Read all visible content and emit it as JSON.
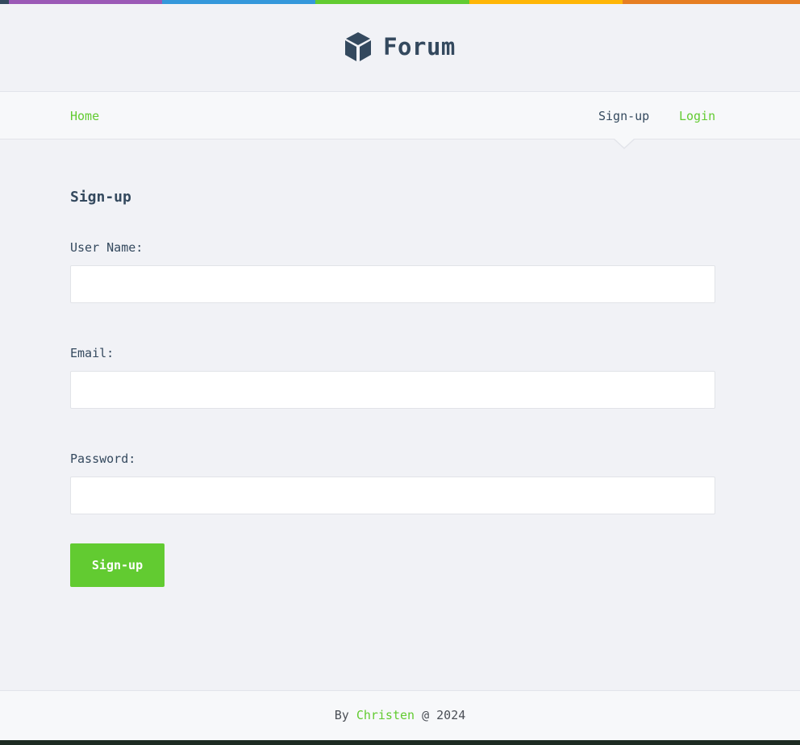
{
  "top_bar_colors": [
    "#34495e",
    "#9b59b6",
    "#3498db",
    "#62cb31",
    "#ffb606",
    "#e67e22"
  ],
  "header": {
    "logo_icon": "cube-icon",
    "title": "Forum"
  },
  "nav": {
    "home": "Home",
    "signup": "Sign-up",
    "login": "Login",
    "active": "Sign-up"
  },
  "form": {
    "title": "Sign-up",
    "username_label": "User Name:",
    "username_value": "",
    "email_label": "Email:",
    "email_value": "",
    "password_label": "Password:",
    "password_value": "",
    "submit_label": "Sign-up"
  },
  "footer": {
    "prefix": "By",
    "author": "Christen",
    "suffix": "@ 2024"
  },
  "colors": {
    "accent": "#62cb31",
    "text": "#34495e",
    "background": "#f1f2f6"
  }
}
